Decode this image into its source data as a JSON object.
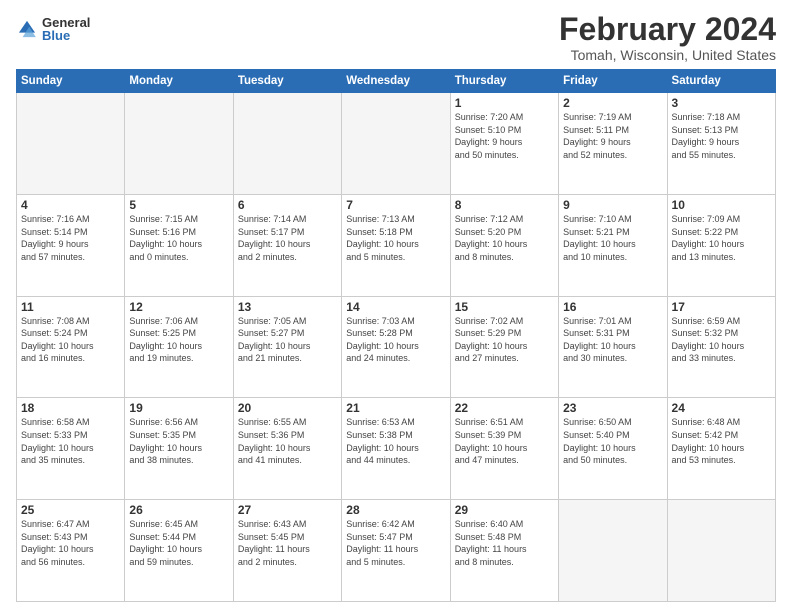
{
  "logo": {
    "general": "General",
    "blue": "Blue"
  },
  "title": "February 2024",
  "location": "Tomah, Wisconsin, United States",
  "headers": [
    "Sunday",
    "Monday",
    "Tuesday",
    "Wednesday",
    "Thursday",
    "Friday",
    "Saturday"
  ],
  "weeks": [
    [
      {
        "day": "",
        "info": ""
      },
      {
        "day": "",
        "info": ""
      },
      {
        "day": "",
        "info": ""
      },
      {
        "day": "",
        "info": ""
      },
      {
        "day": "1",
        "info": "Sunrise: 7:20 AM\nSunset: 5:10 PM\nDaylight: 9 hours\nand 50 minutes."
      },
      {
        "day": "2",
        "info": "Sunrise: 7:19 AM\nSunset: 5:11 PM\nDaylight: 9 hours\nand 52 minutes."
      },
      {
        "day": "3",
        "info": "Sunrise: 7:18 AM\nSunset: 5:13 PM\nDaylight: 9 hours\nand 55 minutes."
      }
    ],
    [
      {
        "day": "4",
        "info": "Sunrise: 7:16 AM\nSunset: 5:14 PM\nDaylight: 9 hours\nand 57 minutes."
      },
      {
        "day": "5",
        "info": "Sunrise: 7:15 AM\nSunset: 5:16 PM\nDaylight: 10 hours\nand 0 minutes."
      },
      {
        "day": "6",
        "info": "Sunrise: 7:14 AM\nSunset: 5:17 PM\nDaylight: 10 hours\nand 2 minutes."
      },
      {
        "day": "7",
        "info": "Sunrise: 7:13 AM\nSunset: 5:18 PM\nDaylight: 10 hours\nand 5 minutes."
      },
      {
        "day": "8",
        "info": "Sunrise: 7:12 AM\nSunset: 5:20 PM\nDaylight: 10 hours\nand 8 minutes."
      },
      {
        "day": "9",
        "info": "Sunrise: 7:10 AM\nSunset: 5:21 PM\nDaylight: 10 hours\nand 10 minutes."
      },
      {
        "day": "10",
        "info": "Sunrise: 7:09 AM\nSunset: 5:22 PM\nDaylight: 10 hours\nand 13 minutes."
      }
    ],
    [
      {
        "day": "11",
        "info": "Sunrise: 7:08 AM\nSunset: 5:24 PM\nDaylight: 10 hours\nand 16 minutes."
      },
      {
        "day": "12",
        "info": "Sunrise: 7:06 AM\nSunset: 5:25 PM\nDaylight: 10 hours\nand 19 minutes."
      },
      {
        "day": "13",
        "info": "Sunrise: 7:05 AM\nSunset: 5:27 PM\nDaylight: 10 hours\nand 21 minutes."
      },
      {
        "day": "14",
        "info": "Sunrise: 7:03 AM\nSunset: 5:28 PM\nDaylight: 10 hours\nand 24 minutes."
      },
      {
        "day": "15",
        "info": "Sunrise: 7:02 AM\nSunset: 5:29 PM\nDaylight: 10 hours\nand 27 minutes."
      },
      {
        "day": "16",
        "info": "Sunrise: 7:01 AM\nSunset: 5:31 PM\nDaylight: 10 hours\nand 30 minutes."
      },
      {
        "day": "17",
        "info": "Sunrise: 6:59 AM\nSunset: 5:32 PM\nDaylight: 10 hours\nand 33 minutes."
      }
    ],
    [
      {
        "day": "18",
        "info": "Sunrise: 6:58 AM\nSunset: 5:33 PM\nDaylight: 10 hours\nand 35 minutes."
      },
      {
        "day": "19",
        "info": "Sunrise: 6:56 AM\nSunset: 5:35 PM\nDaylight: 10 hours\nand 38 minutes."
      },
      {
        "day": "20",
        "info": "Sunrise: 6:55 AM\nSunset: 5:36 PM\nDaylight: 10 hours\nand 41 minutes."
      },
      {
        "day": "21",
        "info": "Sunrise: 6:53 AM\nSunset: 5:38 PM\nDaylight: 10 hours\nand 44 minutes."
      },
      {
        "day": "22",
        "info": "Sunrise: 6:51 AM\nSunset: 5:39 PM\nDaylight: 10 hours\nand 47 minutes."
      },
      {
        "day": "23",
        "info": "Sunrise: 6:50 AM\nSunset: 5:40 PM\nDaylight: 10 hours\nand 50 minutes."
      },
      {
        "day": "24",
        "info": "Sunrise: 6:48 AM\nSunset: 5:42 PM\nDaylight: 10 hours\nand 53 minutes."
      }
    ],
    [
      {
        "day": "25",
        "info": "Sunrise: 6:47 AM\nSunset: 5:43 PM\nDaylight: 10 hours\nand 56 minutes."
      },
      {
        "day": "26",
        "info": "Sunrise: 6:45 AM\nSunset: 5:44 PM\nDaylight: 10 hours\nand 59 minutes."
      },
      {
        "day": "27",
        "info": "Sunrise: 6:43 AM\nSunset: 5:45 PM\nDaylight: 11 hours\nand 2 minutes."
      },
      {
        "day": "28",
        "info": "Sunrise: 6:42 AM\nSunset: 5:47 PM\nDaylight: 11 hours\nand 5 minutes."
      },
      {
        "day": "29",
        "info": "Sunrise: 6:40 AM\nSunset: 5:48 PM\nDaylight: 11 hours\nand 8 minutes."
      },
      {
        "day": "",
        "info": ""
      },
      {
        "day": "",
        "info": ""
      }
    ]
  ]
}
